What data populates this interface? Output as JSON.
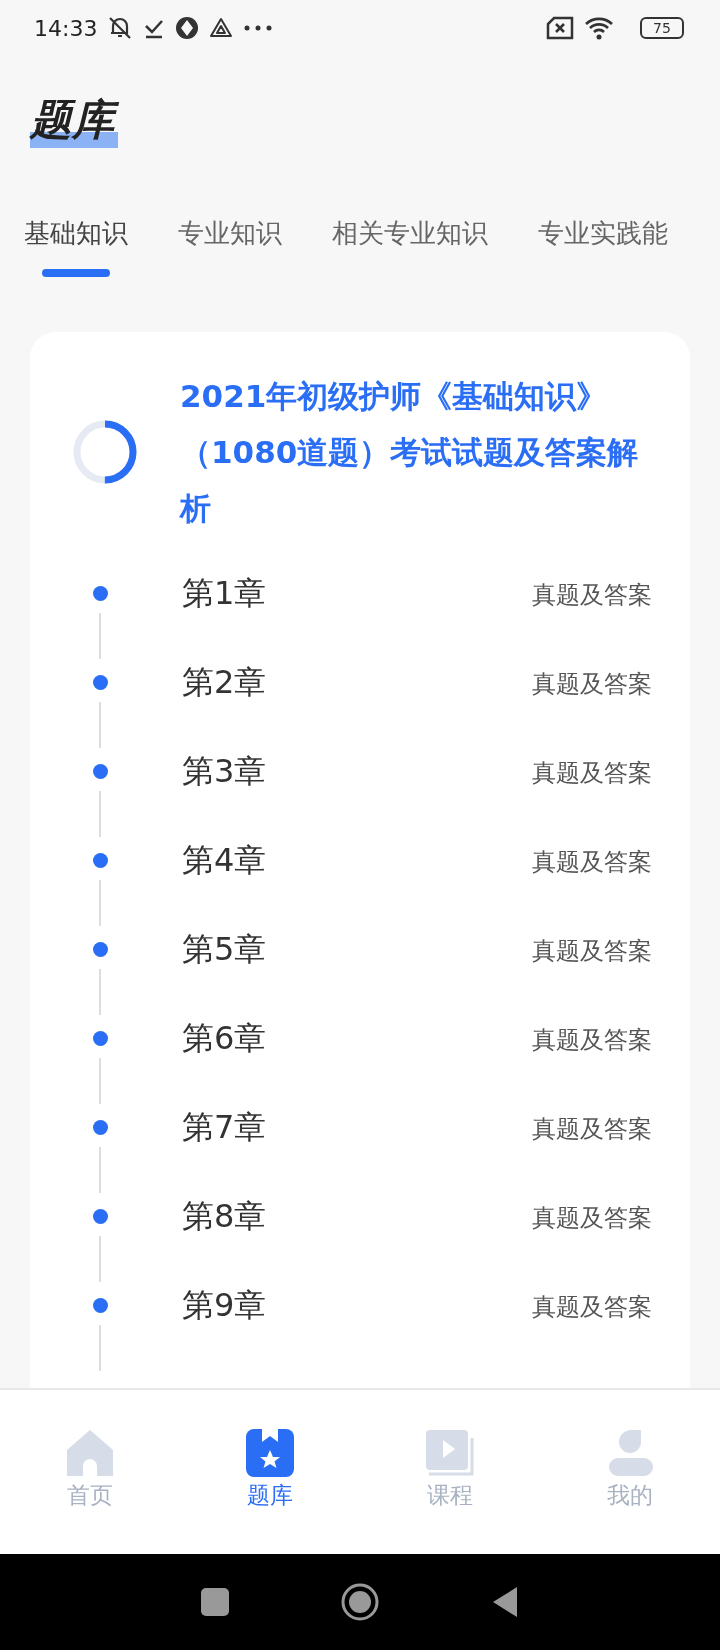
{
  "status_bar": {
    "time": "14:33",
    "battery": "75"
  },
  "header": {
    "title": "题库"
  },
  "tabs": [
    {
      "label": "基础知识",
      "selected": true
    },
    {
      "label": "专业知识",
      "selected": false
    },
    {
      "label": "相关专业知识",
      "selected": false
    },
    {
      "label": "专业实践能",
      "selected": false
    }
  ],
  "paper": {
    "title": "2021年初级护师《基础知识》（1080道题）考试试题及答案解析",
    "level": 0.5,
    "chapters": [
      {
        "name": "第1章",
        "action": "真题及答案"
      },
      {
        "name": "第2章",
        "action": "真题及答案"
      },
      {
        "name": "第3章",
        "action": "真题及答案"
      },
      {
        "name": "第4章",
        "action": "真题及答案"
      },
      {
        "name": "第5章",
        "action": "真题及答案"
      },
      {
        "name": "第6章",
        "action": "真题及答案"
      },
      {
        "name": "第7章",
        "action": "真题及答案"
      },
      {
        "name": "第8章",
        "action": "真题及答案"
      },
      {
        "name": "第9章",
        "action": "真题及答案"
      }
    ]
  },
  "bottom_nav": [
    {
      "label": "首页",
      "kind": "home",
      "selected": false
    },
    {
      "label": "题库",
      "kind": "bank",
      "selected": true
    },
    {
      "label": "课程",
      "kind": "course",
      "selected": false
    },
    {
      "label": "我的",
      "kind": "me",
      "selected": false
    }
  ]
}
